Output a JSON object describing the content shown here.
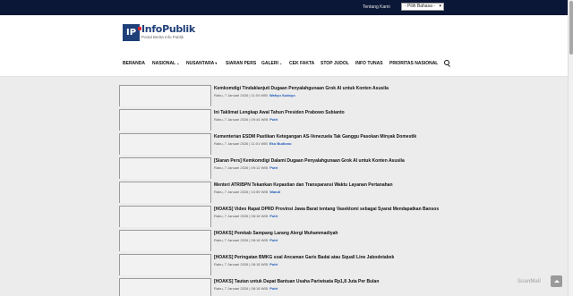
{
  "topbar": {
    "about": "Tentang Kami",
    "language_select": "- Pilih Bahasa -"
  },
  "logo": {
    "name": "InfoPublik",
    "tagline": "Portal Berita Info Publik",
    "mark": "IP"
  },
  "nav": [
    {
      "label": "BERANDA",
      "dropdown": false
    },
    {
      "label": "NASIONAL",
      "dropdown": true
    },
    {
      "label": "NUSANTARA",
      "dropdown": true
    },
    {
      "label": "SIARAN PERS",
      "dropdown": false
    },
    {
      "label": "GALERI",
      "dropdown": true
    },
    {
      "label": "CEK FAKTA",
      "dropdown": false
    },
    {
      "label": "STOP JUDOL",
      "dropdown": false
    },
    {
      "label": "INFO TUNAS",
      "dropdown": false
    },
    {
      "label": "PRIORITAS NASIONAL",
      "dropdown": false
    }
  ],
  "articles": [
    {
      "title": "Kemkomdigi Tindaklanjuti Dugaan Penyalahgunaan Grok AI untuk Konten Asusila",
      "date": "Rabu, 7 Januari 2026 | 11:04 WIB",
      "author": "Wahyu Sudoyo"
    },
    {
      "title": "Ini Taklimat Lengkap Awal Tahun Presiden Prabowo Subianto",
      "date": "Rabu, 7 Januari 2026 | 09:44 WIB",
      "author": "Putri"
    },
    {
      "title": "Kementerian ESDM Pastikan Ketegangan AS-Venezuela Tak Ganggu Pasokan Minyak Domestik",
      "date": "Rabu, 7 Januari 2026 | 11:01 WIB",
      "author": "Eko Budiono"
    },
    {
      "title": "[Siaran Pers] Kemkomdigi Dalami Dugaan Penyalahgunaan Grok AI untuk Konten Asusila",
      "date": "Rabu, 7 Januari 2026 | 09:12 WIB",
      "author": "Putri"
    },
    {
      "title": "Menteri ATR/BPN Tekankan Kepastian dan Transparansi Waktu Layanan Pertanahan",
      "date": "Rabu, 7 Januari 2026 | 10:59 WIB",
      "author": "Wandi"
    },
    {
      "title": "[HOAKS] Video Rapat DPRD Provinsi Jawa Barat tentang Vasektomi sebagai Syarat Mendapatkan Bansos",
      "date": "Rabu, 7 Januari 2026 | 08:18 WIB",
      "author": "Putri"
    },
    {
      "title": "[HOAKS] Pemkab Sampang Larang Alergi Muhammadiyah",
      "date": "Rabu, 7 Januari 2026 | 08:18 WIB",
      "author": "Putri"
    },
    {
      "title": "[HOAKS] Peringatan BMKG soal Ancaman Garis Badai atau Squall Line Jabodetabek",
      "date": "Rabu, 7 Januari 2026 | 08:18 WIB",
      "author": "Putri"
    },
    {
      "title": "[HOAKS] Tautan untuk Dapat Bantuan Usaha Pariwisata Rp1,8 Juta Per Bulan",
      "date": "Rabu, 7 Januari 2026 | 08:18 WIB",
      "author": "Putri"
    }
  ],
  "watermark": "ScanMail",
  "colors": {
    "topbar": "#0b1736",
    "brand": "#1f3f78",
    "author_link": "#1a57b8"
  }
}
